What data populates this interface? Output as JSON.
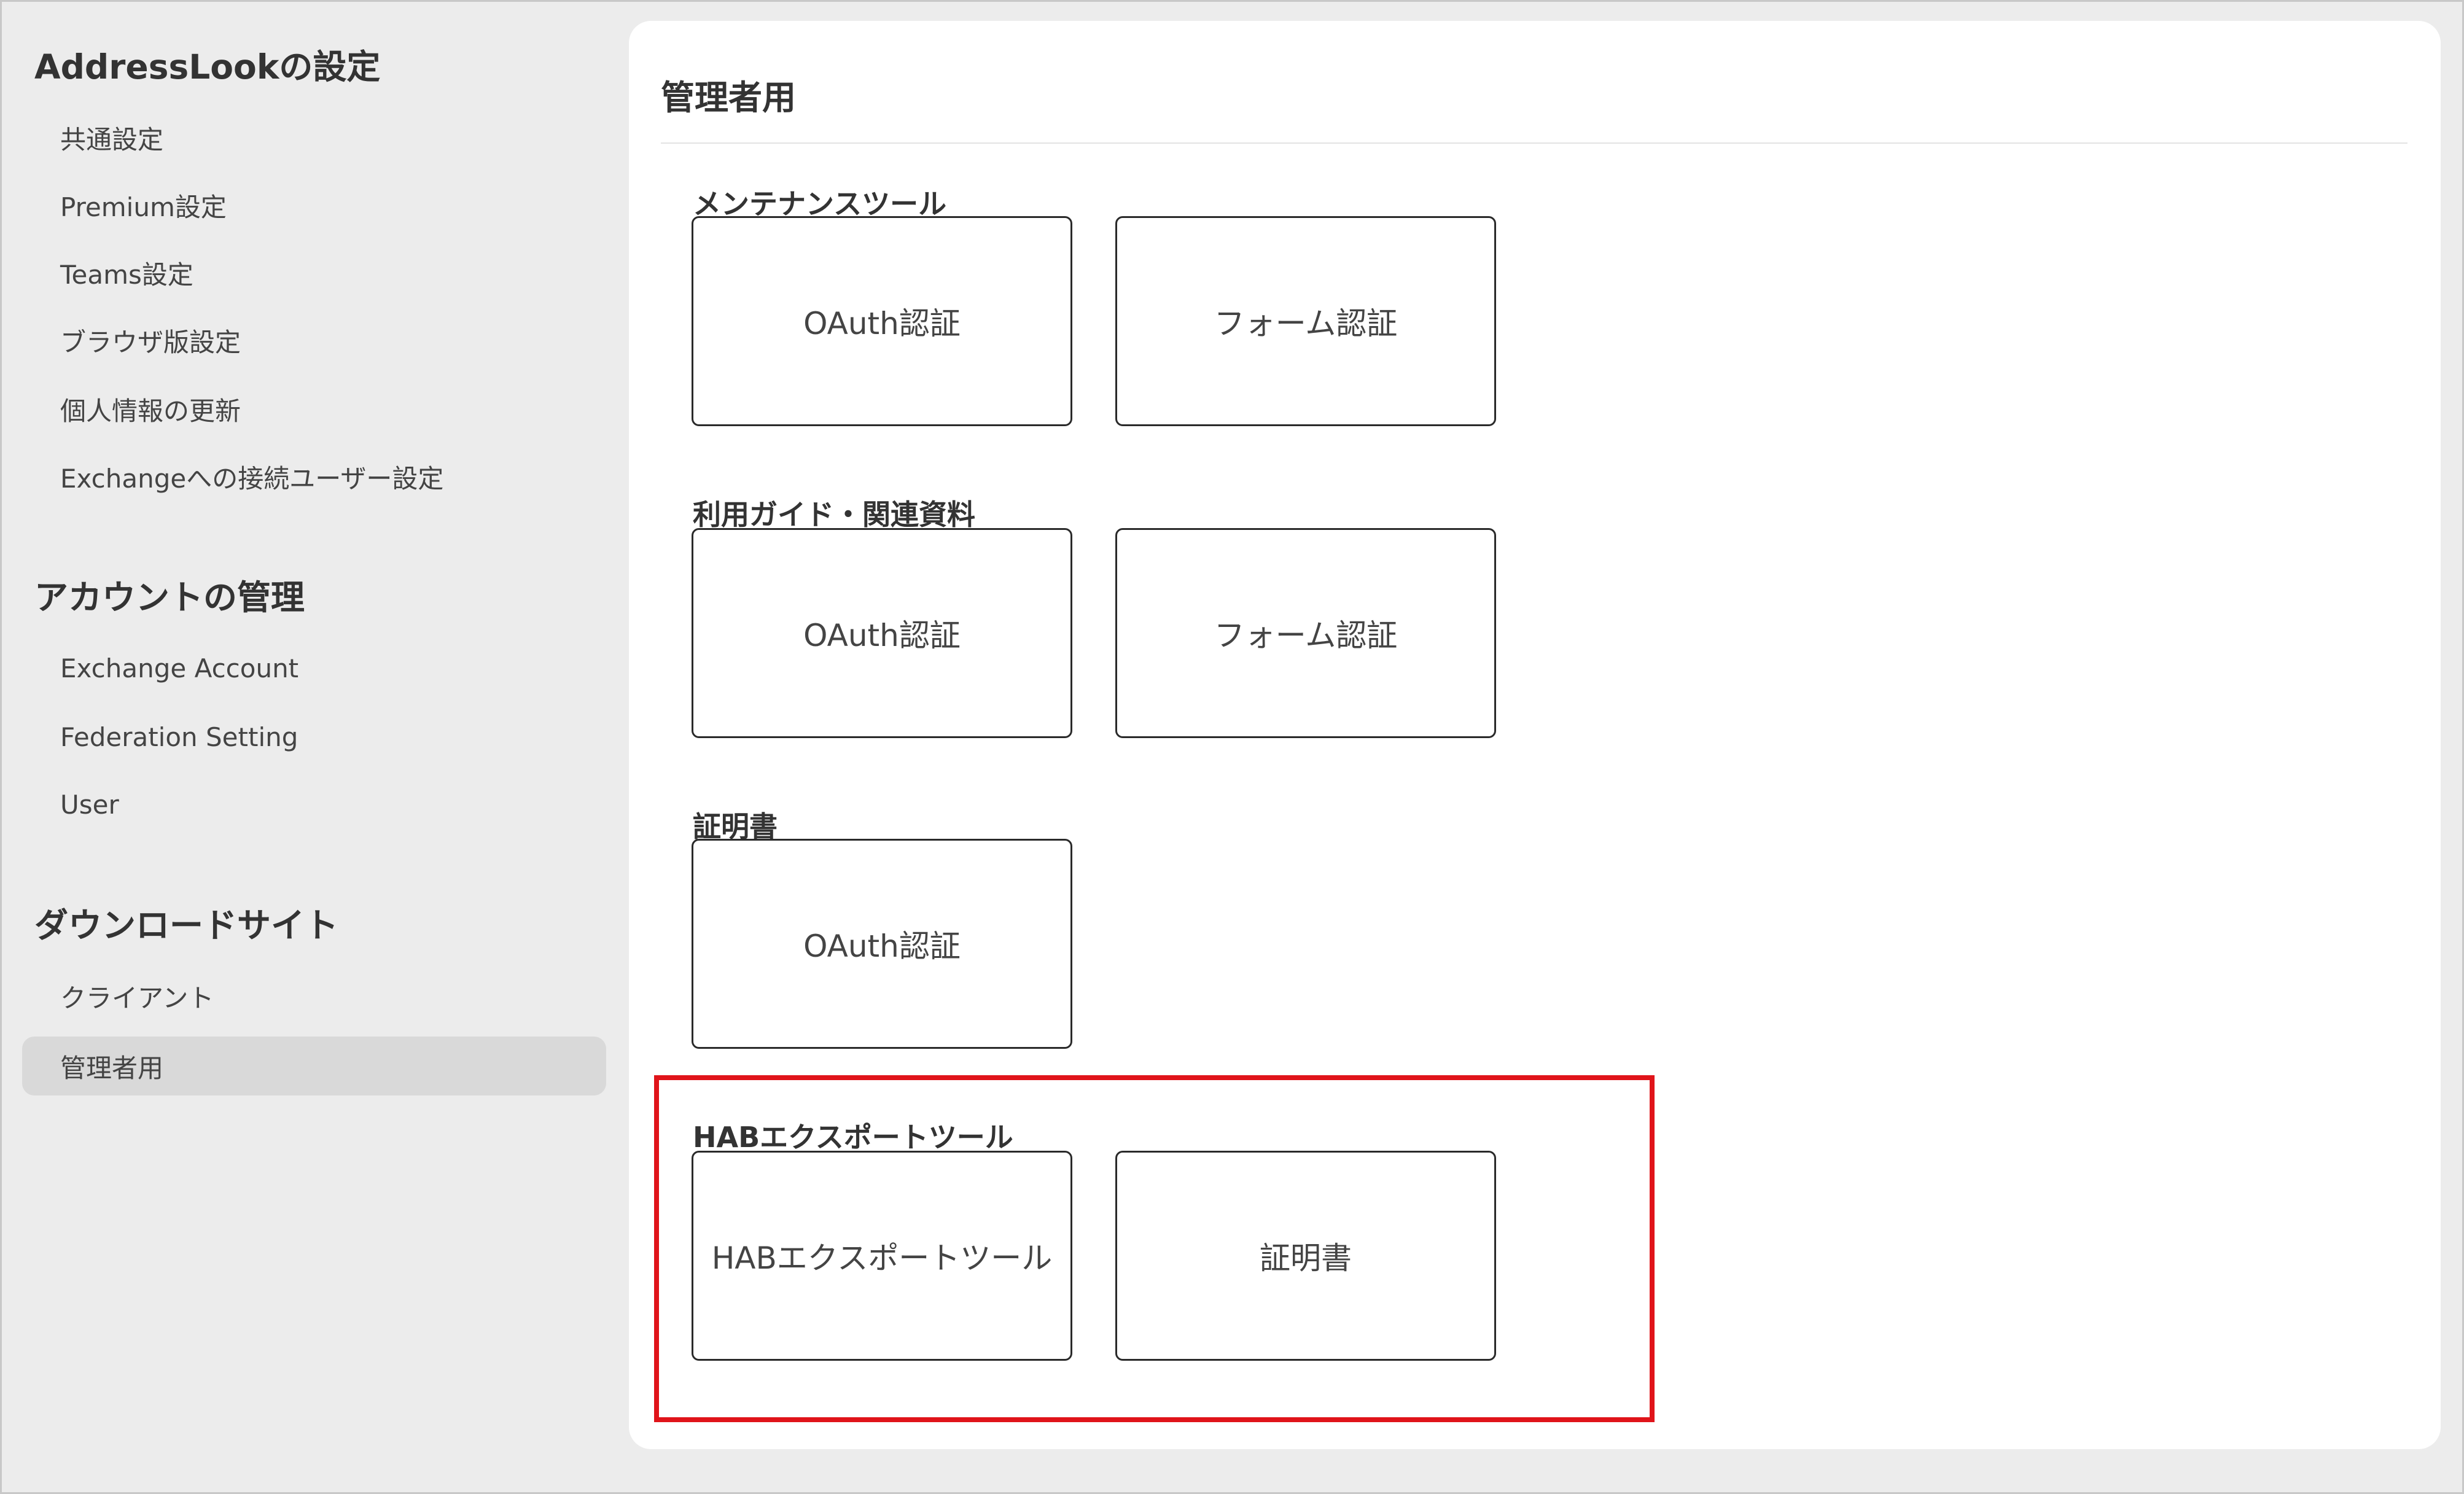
{
  "sidebar": {
    "sections": [
      {
        "title": "AddressLookの設定",
        "items": [
          "共通設定",
          "Premium設定",
          "Teams設定",
          "ブラウザ版設定",
          "個人情報の更新",
          "Exchangeへの接続ユーザー設定"
        ]
      },
      {
        "title": "アカウントの管理",
        "items": [
          "Exchange Account",
          "Federation Setting",
          "User"
        ]
      },
      {
        "title": "ダウンロードサイト",
        "items": [
          "クライアント",
          "管理者用"
        ]
      }
    ],
    "active_item": "管理者用"
  },
  "main": {
    "title": "管理者用",
    "groups": [
      {
        "title": "メンテナンスツール",
        "tiles": [
          "OAuth認証",
          "フォーム認証"
        ]
      },
      {
        "title": "利用ガイド・関連資料",
        "tiles": [
          "OAuth認証",
          "フォーム認証"
        ]
      },
      {
        "title": "証明書",
        "tiles": [
          "OAuth認証"
        ]
      },
      {
        "title": "HABエクスポートツール",
        "tiles": [
          "HABエクスポートツール",
          "証明書"
        ]
      }
    ]
  },
  "colors": {
    "background": "#ececec",
    "panel": "#ffffff",
    "active_item_bg": "#d9d9d9",
    "highlight_border": "#e0141a",
    "tile_border": "#2a2a2a"
  }
}
